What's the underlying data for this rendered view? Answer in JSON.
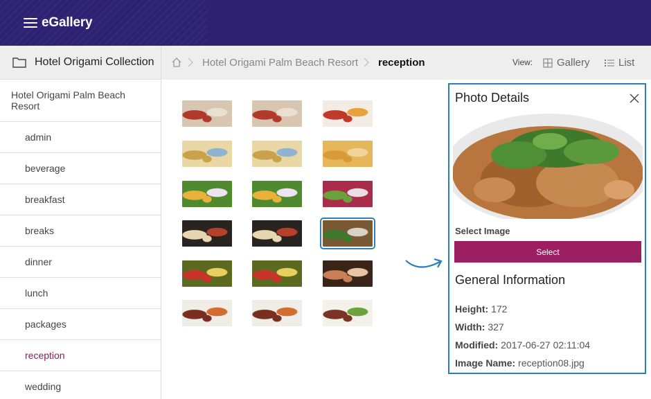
{
  "app": {
    "brand": "eGallery"
  },
  "sidebar": {
    "collection_title": "Hotel Origami Collection",
    "root_label": "Hotel Origami Palm Beach Resort",
    "items": [
      {
        "label": "admin",
        "active": false
      },
      {
        "label": "beverage",
        "active": false
      },
      {
        "label": "breakfast",
        "active": false
      },
      {
        "label": "breaks",
        "active": false
      },
      {
        "label": "dinner",
        "active": false
      },
      {
        "label": "lunch",
        "active": false
      },
      {
        "label": "packages",
        "active": false
      },
      {
        "label": "reception",
        "active": true
      },
      {
        "label": "wedding",
        "active": false
      }
    ]
  },
  "breadcrumb": {
    "home_icon": "home-icon",
    "items": [
      "Hotel Origami Palm Beach Resort",
      "reception"
    ]
  },
  "view": {
    "label": "View:",
    "gallery_label": "Gallery",
    "list_label": "List",
    "gallery_icon": "grid-icon",
    "list_icon": "list-icon"
  },
  "thumbnails": {
    "selected_index": 11,
    "count": 18
  },
  "details": {
    "title": "Photo Details",
    "close_icon": "close-icon",
    "select_image_label": "Select Image",
    "select_button": "Select",
    "general_title": "General Information",
    "fields": [
      {
        "label": "Height:",
        "value": "172"
      },
      {
        "label": "Width:",
        "value": "327"
      },
      {
        "label": "Modified:",
        "value": "2017-06-27 02:11:04"
      },
      {
        "label": "Image Name:",
        "value": "reception08.jpg"
      }
    ]
  },
  "colors": {
    "topbar": "#2d2170",
    "accent": "#9c1f61",
    "active_item": "#8b1e5a",
    "selection_border": "#2a7db5"
  }
}
